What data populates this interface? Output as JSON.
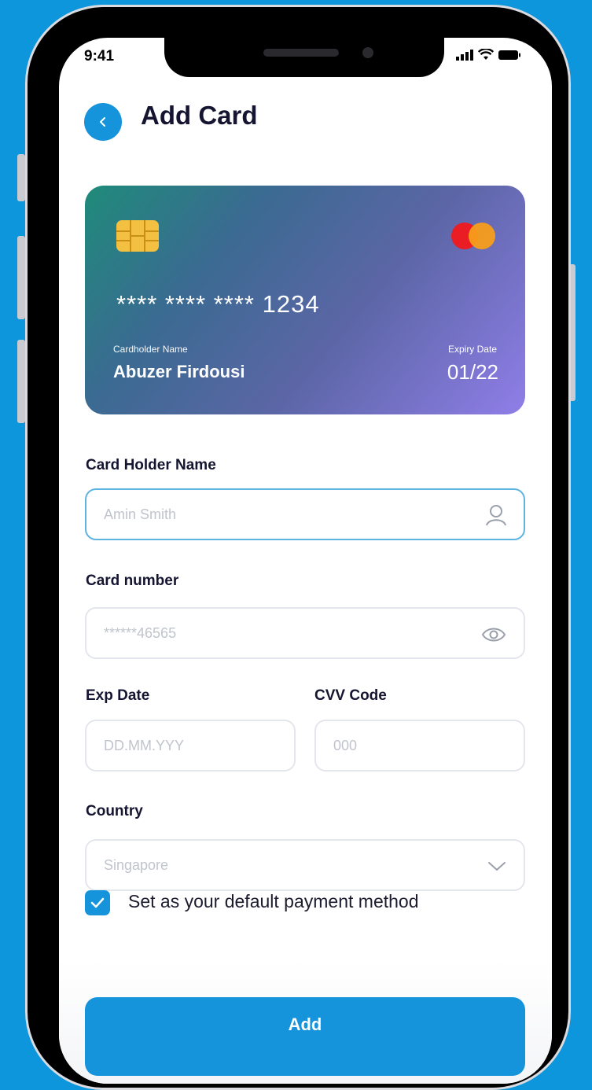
{
  "status_bar": {
    "time": "9:41"
  },
  "header": {
    "title": "Add Card"
  },
  "card": {
    "number": "**** **** **** 1234",
    "holder_label": "Cardholder Name",
    "holder_name": "Abuzer Firdousi",
    "expiry_label": "Expiry Date",
    "expiry_value": "01/22"
  },
  "form": {
    "holder_name": {
      "label": "Card Holder Name",
      "placeholder": "Amin Smith"
    },
    "card_number": {
      "label": "Card number",
      "placeholder": "******46565"
    },
    "exp_date": {
      "label": "Exp Date",
      "placeholder": "DD.MM.YYY"
    },
    "cvv": {
      "label": "CVV Code",
      "placeholder": "000"
    },
    "country": {
      "label": "Country",
      "placeholder": "Singapore"
    },
    "default_payment": {
      "label": "Set as your default payment method",
      "checked": true
    }
  },
  "footer": {
    "add_button_label": "Add"
  },
  "colors": {
    "accent": "#1593DB",
    "background": "#0E96DC",
    "title": "#151532"
  }
}
